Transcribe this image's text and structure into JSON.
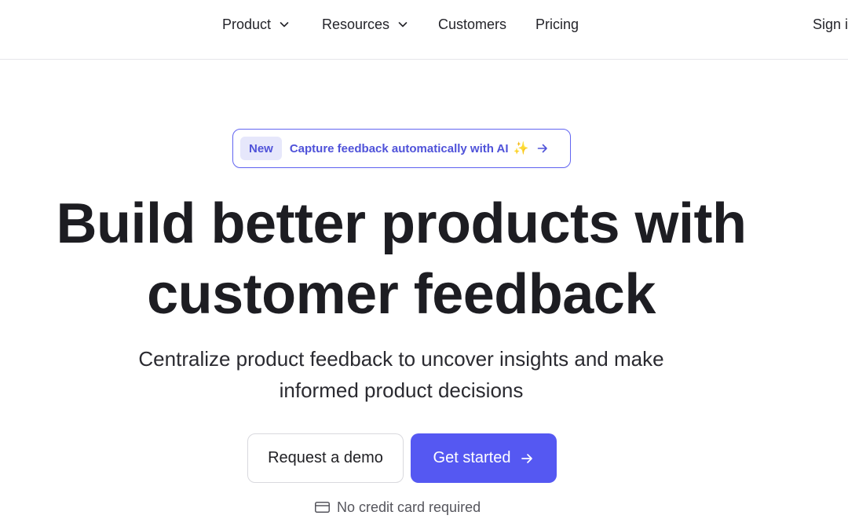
{
  "nav": {
    "items": [
      {
        "label": "Product",
        "has_dropdown": true
      },
      {
        "label": "Resources",
        "has_dropdown": true
      },
      {
        "label": "Customers",
        "has_dropdown": false
      },
      {
        "label": "Pricing",
        "has_dropdown": false
      }
    ],
    "signin_label": "Sign i",
    "dropdown_icon": "chevron-down-icon"
  },
  "announcement": {
    "badge": "New",
    "message": "Capture feedback automatically with AI",
    "emoji": "✨",
    "arrow_icon": "arrow-right-icon"
  },
  "hero": {
    "title_line1": "Build better products with",
    "title_line2": "customer feedback",
    "subtitle_line1": "Centralize product feedback to uncover insights and make",
    "subtitle_line2": "informed product decisions"
  },
  "cta": {
    "secondary_label": "Request a demo",
    "primary_label": "Get started",
    "primary_icon": "arrow-right-icon"
  },
  "note": {
    "icon": "credit-card-icon",
    "text": "No credit card required"
  },
  "colors": {
    "accent": "#5558f2",
    "accent_text": "#4f52d9",
    "badge_bg": "#e6e7fb",
    "sparkle": "#f5b400"
  }
}
